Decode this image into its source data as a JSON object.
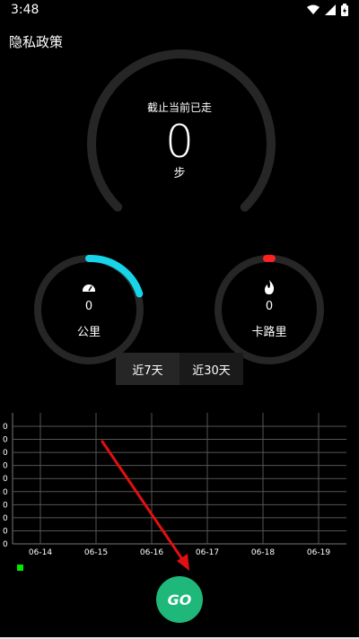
{
  "status_bar": {
    "time": "3:48"
  },
  "header": {
    "title": "隐私政策"
  },
  "steps_gauge": {
    "caption": "截止当前已走",
    "value": "0",
    "unit": "步",
    "progress": 0
  },
  "distance": {
    "value": "0",
    "label": "公里",
    "icon": "speedometer-icon",
    "accent": "#17d4e8"
  },
  "calories": {
    "value": "0",
    "label": "卡路里",
    "icon": "flame-icon",
    "accent": "#ff2020"
  },
  "period_tabs": {
    "tab_7": "近7天",
    "tab_30": "近30天",
    "selected": "近7天"
  },
  "chart_data": {
    "type": "line",
    "x": [
      "06-14",
      "06-15",
      "06-16",
      "06-17",
      "06-18",
      "06-19"
    ],
    "y_ticks": [
      "0",
      "0",
      "0",
      "0",
      "0",
      "0",
      "0",
      "0",
      "0",
      "0"
    ],
    "series": [
      {
        "values": [
          0,
          0,
          0,
          0,
          0,
          0
        ],
        "color": "#00e600"
      }
    ],
    "grid": true
  },
  "go_button": {
    "label": "GO"
  },
  "annotation": {
    "arrow_color": "#e01010"
  }
}
